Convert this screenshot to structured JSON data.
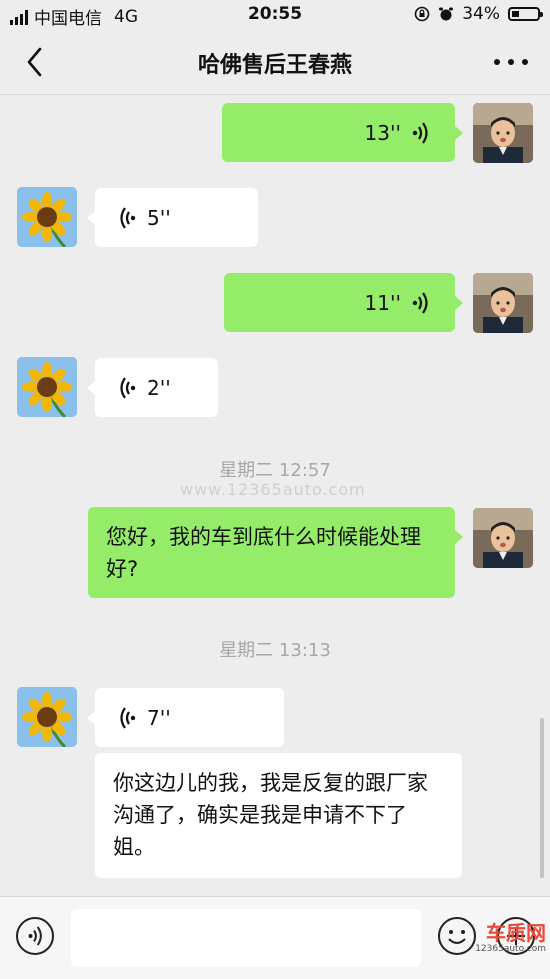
{
  "status_bar": {
    "carrier": "中国电信",
    "network": "4G",
    "time": "20:55",
    "battery": "34%"
  },
  "header": {
    "title": "哈佛售后王春燕"
  },
  "messages": [
    {
      "side": "right",
      "type": "voice",
      "duration": "13''"
    },
    {
      "side": "left",
      "type": "voice",
      "duration": "5''"
    },
    {
      "side": "right",
      "type": "voice",
      "duration": "11''"
    },
    {
      "side": "left",
      "type": "voice",
      "duration": "2''"
    },
    {
      "type": "time",
      "text": "星期二 12:57"
    },
    {
      "side": "right",
      "type": "text",
      "text": "您好，我的车到底什么时候能处理好?"
    },
    {
      "type": "time",
      "text": "星期二 13:13"
    },
    {
      "side": "left",
      "type": "voice",
      "duration": "7''"
    },
    {
      "side": "left",
      "type": "text",
      "text": "你这边儿的我，我是反复的跟厂家沟通了，确实是我是申请不下了姐。"
    }
  ],
  "watermark": "www.12365auto.com",
  "corner_logo": {
    "name": "车质网",
    "site": "12365auto.com"
  },
  "icons": [
    "back-chevron-icon",
    "more-icon",
    "voice-wave-icon",
    "voice-input-icon",
    "emoji-icon",
    "plus-icon",
    "sunflower-avatar",
    "person-avatar"
  ],
  "colors": {
    "bubble_green": "#95ec69",
    "bubble_white": "#ffffff",
    "background": "#ededed"
  }
}
